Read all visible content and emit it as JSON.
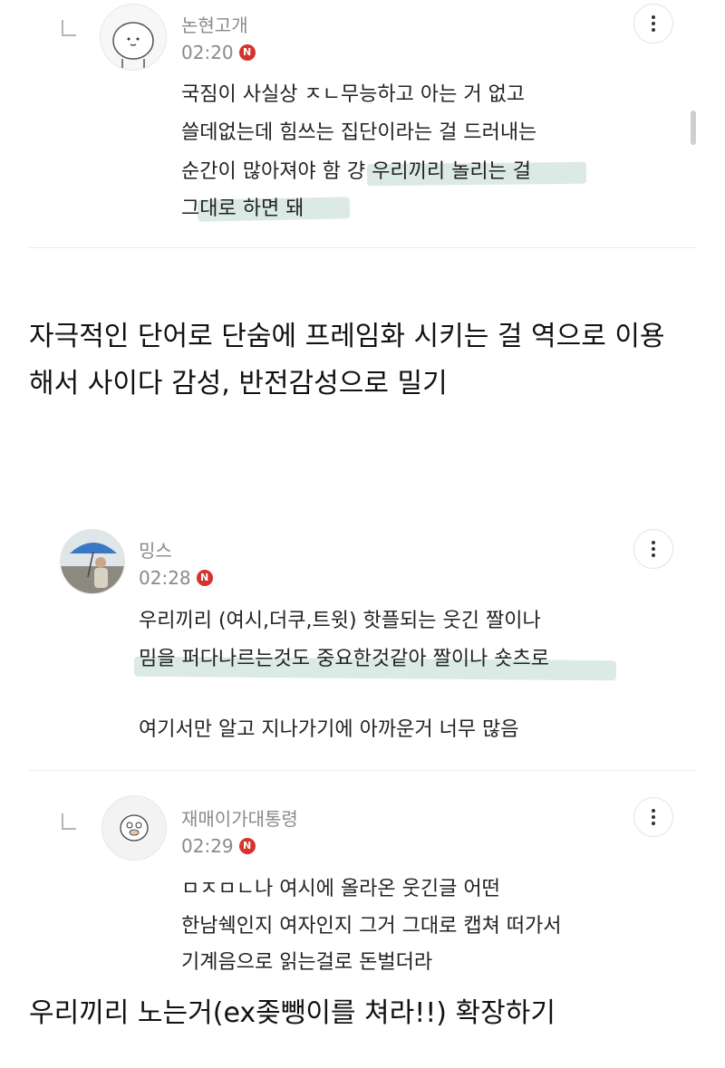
{
  "comment1": {
    "nickname": "논현고개",
    "time": "02:20",
    "badge": "N",
    "lines": [
      "국짐이 사실상 ㅈㄴ무능하고 아는 거 없고",
      "쓸데없는데 힘쓰는 집단이라는 걸 드러내는",
      "순간이 많아져야 함 걍 우리끼리 놀리는 걸",
      "그대로 하면 돼"
    ]
  },
  "body1": {
    "lines": [
      "자극적인 단어로 단숨에 프레임화 시키는 걸 역으로 이용",
      "해서 사이다 감성, 반전감성으로 밀기"
    ]
  },
  "comment2": {
    "nickname": "밍스",
    "time": "02:28",
    "badge": "N",
    "lines": [
      "우리끼리 (여시,더쿠,트윗) 핫플되는 웃긴 짤이나",
      "밈을 퍼다나르는것도 중요한것같아 짤이나 숏츠로",
      "여기서만 알고 지나가기에 아까운거 너무 많음"
    ]
  },
  "comment3": {
    "nickname": "재매이가대통령",
    "time": "02:29",
    "badge": "N",
    "lines": [
      "ㅁㅈㅁㄴ나 여시에 올라온 웃긴글 어떤",
      "한남쉑인지 여자인지 그거 그대로 캡쳐 떠가서",
      "기계음으로 읽는걸로 돈벌더라"
    ]
  },
  "body2": {
    "lines": [
      "우리끼리 노는거(ex좆뺑이를 쳐라!!) 확장하기"
    ]
  },
  "icons": {
    "more": "more-vertical-icon",
    "reply": "reply-arrow-icon",
    "new_badge": "new-badge-icon"
  },
  "colors": {
    "highlight": "#d7e8e2",
    "badge": "#d6322e",
    "meta_text": "#8a8a8a"
  }
}
